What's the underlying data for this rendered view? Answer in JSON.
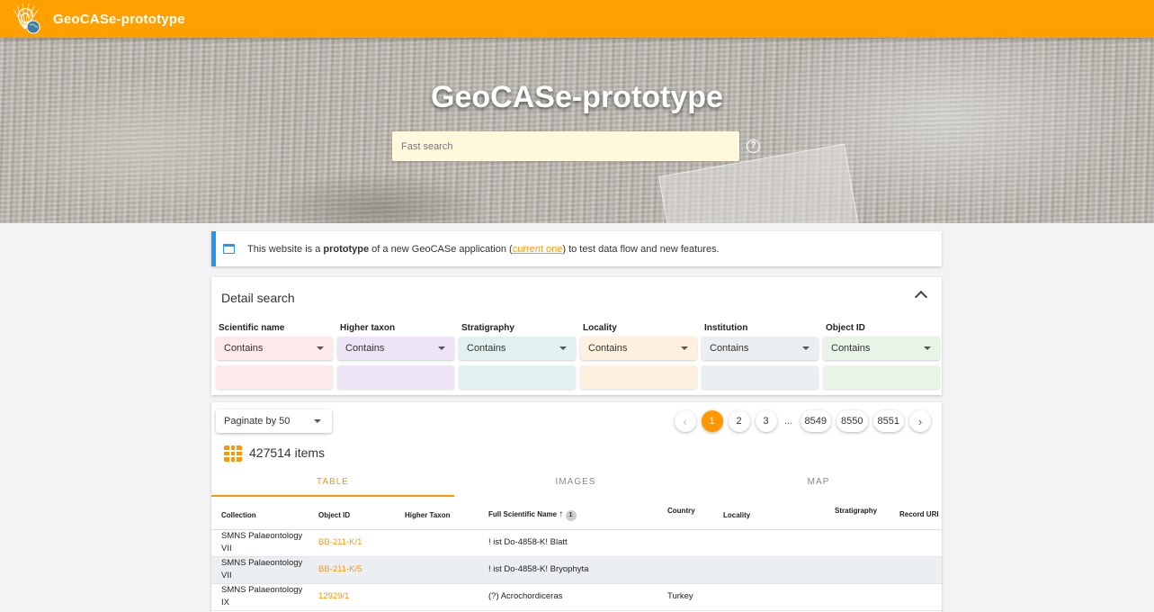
{
  "app": {
    "title": "GeoCASe-prototype"
  },
  "hero": {
    "title": "GeoCASe-prototype",
    "search_placeholder": "Fast search"
  },
  "notice": {
    "text_before": "This website is a ",
    "bold": "prototype",
    "text_mid": " of a new GeoCASe application (",
    "link": "current one",
    "text_after": ") to test data flow and new features."
  },
  "detail_search": {
    "title": "Detail search",
    "fields": [
      {
        "label": "Scientific name",
        "mode": "Contains",
        "color": "#fde8ea"
      },
      {
        "label": "Higher taxon",
        "mode": "Contains",
        "color": "#ede5f5"
      },
      {
        "label": "Stratigraphy",
        "mode": "Contains",
        "color": "#e0f1ef"
      },
      {
        "label": "Locality",
        "mode": "Contains",
        "color": "#fdf0de"
      },
      {
        "label": "Institution",
        "mode": "Contains",
        "color": "#eceff1"
      },
      {
        "label": "Object ID",
        "mode": "Contains",
        "color": "#e7f4e7"
      }
    ]
  },
  "results": {
    "paginate_label": "Paginate by 50",
    "pages": [
      "1",
      "2",
      "3",
      "8549",
      "8550",
      "8551"
    ],
    "ellipsis": "...",
    "active_page": "1",
    "items_count": "427514 items",
    "tabs": [
      "TABLE",
      "IMAGES",
      "MAP"
    ],
    "columns": [
      "Collection",
      "Object ID",
      "Higher Taxon",
      "Full Scientific Name",
      "Country",
      "Locality",
      "Stratigraphy",
      "Record URI"
    ],
    "sort_badge": "1",
    "rows": [
      {
        "collection": "SMNS Palaeontology VII",
        "object_id": "BB-211-K/1",
        "higher_taxon": "",
        "name": "! ist Do-4858-K! Blatt",
        "country": "",
        "locality": "",
        "stratigraphy": "",
        "uri": ""
      },
      {
        "collection": "SMNS Palaeontology VII",
        "object_id": "BB-211-K/5",
        "higher_taxon": "",
        "name": "! ist Do-4858-K! Bryophyta",
        "country": "",
        "locality": "",
        "stratigraphy": "",
        "uri": ""
      },
      {
        "collection": "SMNS Palaeontology IX",
        "object_id": "12929/1",
        "higher_taxon": "",
        "name": "(?) Acrochordiceras",
        "country": "Turkey",
        "locality": "",
        "stratigraphy": "",
        "uri": ""
      }
    ]
  },
  "colors": {
    "accent": "#ffa000",
    "info": "#2196f3"
  }
}
